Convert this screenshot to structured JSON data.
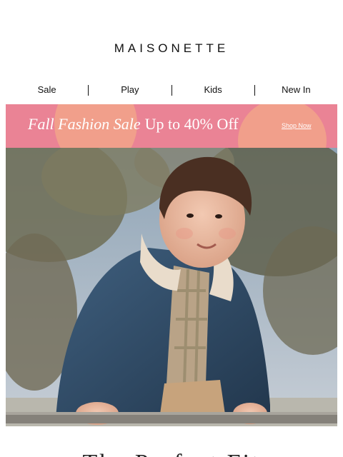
{
  "brand": {
    "logo_text": "MAISONETTE"
  },
  "nav": {
    "items": [
      "Sale",
      "Play",
      "Kids",
      "New In"
    ]
  },
  "banner": {
    "title": "Fall Fashion Sale",
    "offer": "Up to 40% Off",
    "cta": "Shop Now",
    "colors": {
      "background": "#ea8395",
      "accent": "#f2a28a"
    }
  },
  "hero": {
    "image": "toddler-in-denim-sherpa-jacket-on-fence"
  },
  "section": {
    "heading_partial": "The Perfect Fit"
  }
}
